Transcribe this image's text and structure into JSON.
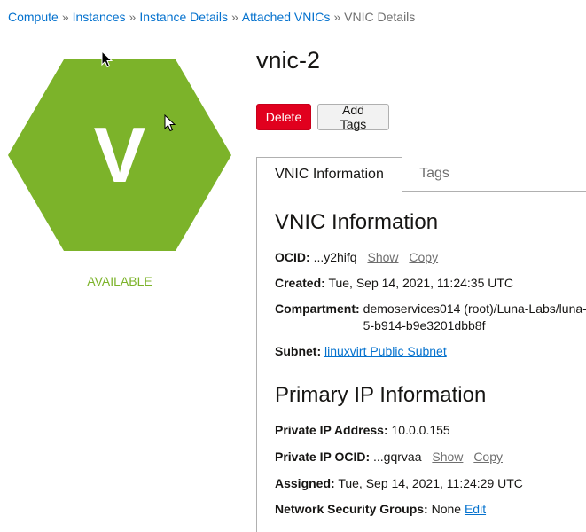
{
  "breadcrumb": {
    "items": [
      "Compute",
      "Instances",
      "Instance Details",
      "Attached VNICs"
    ],
    "separator": "»",
    "current": "VNIC Details"
  },
  "status": {
    "letter": "V",
    "label": "AVAILABLE",
    "color": "#7cb32a"
  },
  "header": {
    "title": "vnic-2"
  },
  "toolbar": {
    "delete_label": "Delete",
    "add_tags_label": "Add Tags"
  },
  "tabs": [
    {
      "label": "VNIC Information",
      "active": true
    },
    {
      "label": "Tags",
      "active": false
    }
  ],
  "vnic_info": {
    "section_title": "VNIC Information",
    "ocid_label": "OCID:",
    "ocid_value": "...y2hifq",
    "show_label": "Show",
    "copy_label": "Copy",
    "created_label": "Created:",
    "created_value": "Tue, Sep 14, 2021, 11:24:35 UTC",
    "compartment_label": "Compartment:",
    "compartment_value": "demoservices014 (root)/Luna-Labs/luna-5-b914-b9e3201dbb8f",
    "subnet_label": "Subnet:",
    "subnet_value": "linuxvirt Public Subnet"
  },
  "primary_ip": {
    "section_title": "Primary IP Information",
    "private_ip_label": "Private IP Address:",
    "private_ip_value": "10.0.0.155",
    "private_ip_ocid_label": "Private IP OCID:",
    "private_ip_ocid_value": "...gqrvaa",
    "show_label": "Show",
    "copy_label": "Copy",
    "assigned_label": "Assigned:",
    "assigned_value": "Tue, Sep 14, 2021, 11:24:29 UTC",
    "nsg_label": "Network Security Groups:",
    "nsg_value": "None",
    "edit_label": "Edit"
  },
  "colors": {
    "link": "#0572ce",
    "danger": "#e1001e",
    "available": "#7cb32a"
  }
}
